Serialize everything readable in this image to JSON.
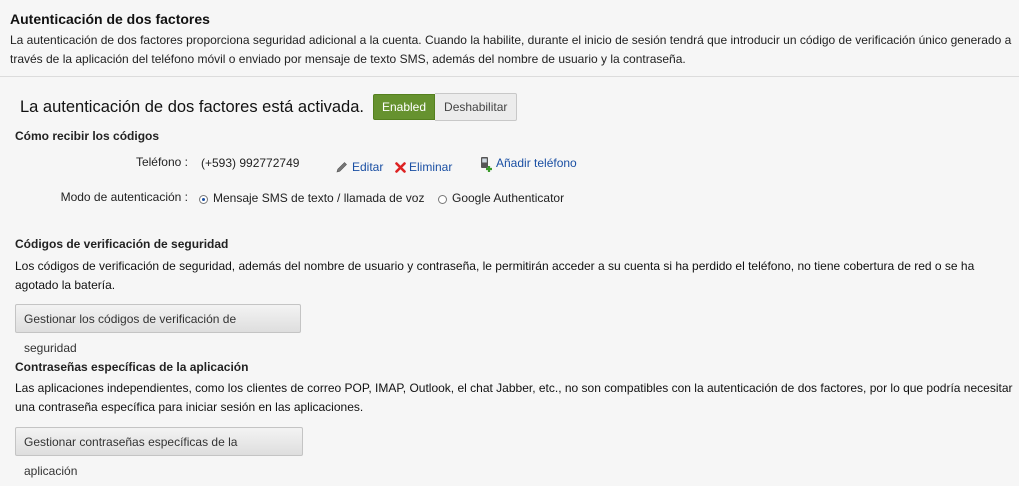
{
  "header": {
    "title": "Autenticación de dos factores",
    "description": "La autenticación de dos factores proporciona seguridad adicional a la cuenta. Cuando la habilite, durante el inicio de sesión tendrá que introducir un código de verificación único generado a través de la aplicación del teléfono móvil o enviado por mensaje de texto SMS, además del nombre de usuario y la contraseña."
  },
  "status": {
    "text": "La autenticación de dos factores está activada.",
    "enabled_label": "Enabled",
    "disable_label": "Deshabilitar"
  },
  "receive": {
    "title": "Cómo recibir los códigos",
    "phone_label": "Teléfono :",
    "phone_value": "(+593) 992772749",
    "edit_label": "Editar",
    "delete_label": "Eliminar",
    "add_phone_label": "Añadir teléfono",
    "mode_label": "Modo de autenticación :",
    "mode_options": [
      "Mensaje SMS de texto / llamada de voz",
      "Google Authenticator"
    ],
    "mode_selected": "Mensaje SMS de texto / llamada de voz",
    "icons": [
      "pencil-icon",
      "delete-x-icon",
      "add-phone-icon"
    ]
  },
  "security_codes": {
    "title": "Códigos de verificación de seguridad",
    "description": "Los códigos de verificación de seguridad, además del nombre de usuario y contraseña, le permitirán acceder a su cuenta si ha perdido el teléfono, no tiene cobertura de red o se ha agotado la batería.",
    "button_label": "Gestionar los códigos de verificación de seguridad"
  },
  "app_passwords": {
    "title": "Contraseñas específicas de la aplicación",
    "description": "Las aplicaciones independientes, como los clientes de correo POP, IMAP, Outlook, el chat Jabber, etc., no son compatibles con la autenticación de dos factores, por lo que podría necesitar una contraseña específica para iniciar sesión en las aplicaciones.",
    "button_label": "Gestionar contraseñas específicas de la aplicación"
  },
  "colors": {
    "enabled_green": "#66922f",
    "link_blue": "#1a4fa3",
    "delete_red": "#d22"
  }
}
